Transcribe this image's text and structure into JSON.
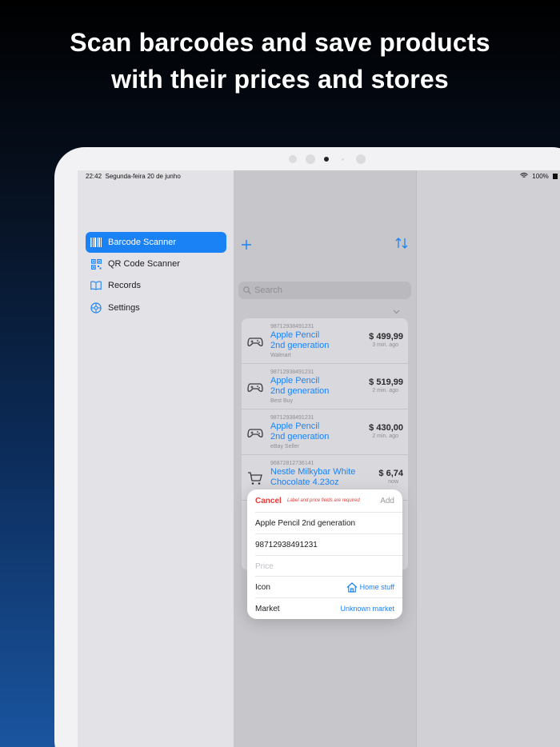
{
  "headline": {
    "line1": "Scan barcodes and save products",
    "line2": "with their prices and stores"
  },
  "status": {
    "time": "22:42",
    "date": "Segunda-feira 20 de junho",
    "battery": "100%"
  },
  "sidebar": {
    "items": [
      {
        "label": "Barcode Scanner",
        "icon": "barcode-icon"
      },
      {
        "label": "QR Code Scanner",
        "icon": "qrcode-icon"
      },
      {
        "label": "Records",
        "icon": "book-icon"
      },
      {
        "label": "Settings",
        "icon": "gear-icon"
      }
    ]
  },
  "search": {
    "placeholder": "Search"
  },
  "records": [
    {
      "code": "98712938491231",
      "name_line1": "Apple Pencil",
      "name_line2": "2nd generation",
      "store": "Walmart",
      "price": "$ 499,99",
      "ago": "3 min. ago",
      "icon": "gamepad-icon"
    },
    {
      "code": "98712938491231",
      "name_line1": "Apple Pencil",
      "name_line2": "2nd generation",
      "store": "Best Buy",
      "price": "$ 519,99",
      "ago": "2 min. ago",
      "icon": "gamepad-icon"
    },
    {
      "code": "98712938491231",
      "name_line1": "Apple Pencil",
      "name_line2": "2nd generation",
      "store": "eBay Seller",
      "price": "$ 430,00",
      "ago": "2 min. ago",
      "icon": "gamepad-icon"
    },
    {
      "code": "96872812736141",
      "name_line1": "Nestle Milkybar White",
      "name_line2": "Chocolate 4.23oz",
      "store": "",
      "price": "$ 6,74",
      "ago": "now",
      "icon": "cart-icon"
    }
  ],
  "popup": {
    "cancel": "Cancel",
    "warning": "Label and price fields are required",
    "add": "Add",
    "label_value": "Apple Pencil 2nd generation",
    "code_value": "98712938491231",
    "price_placeholder": "Price",
    "icon_label": "Icon",
    "icon_value": "Home stuff",
    "market_label": "Market",
    "market_value": "Unknown market"
  },
  "colors": {
    "accent": "#1a82f5",
    "danger": "#e53935"
  }
}
